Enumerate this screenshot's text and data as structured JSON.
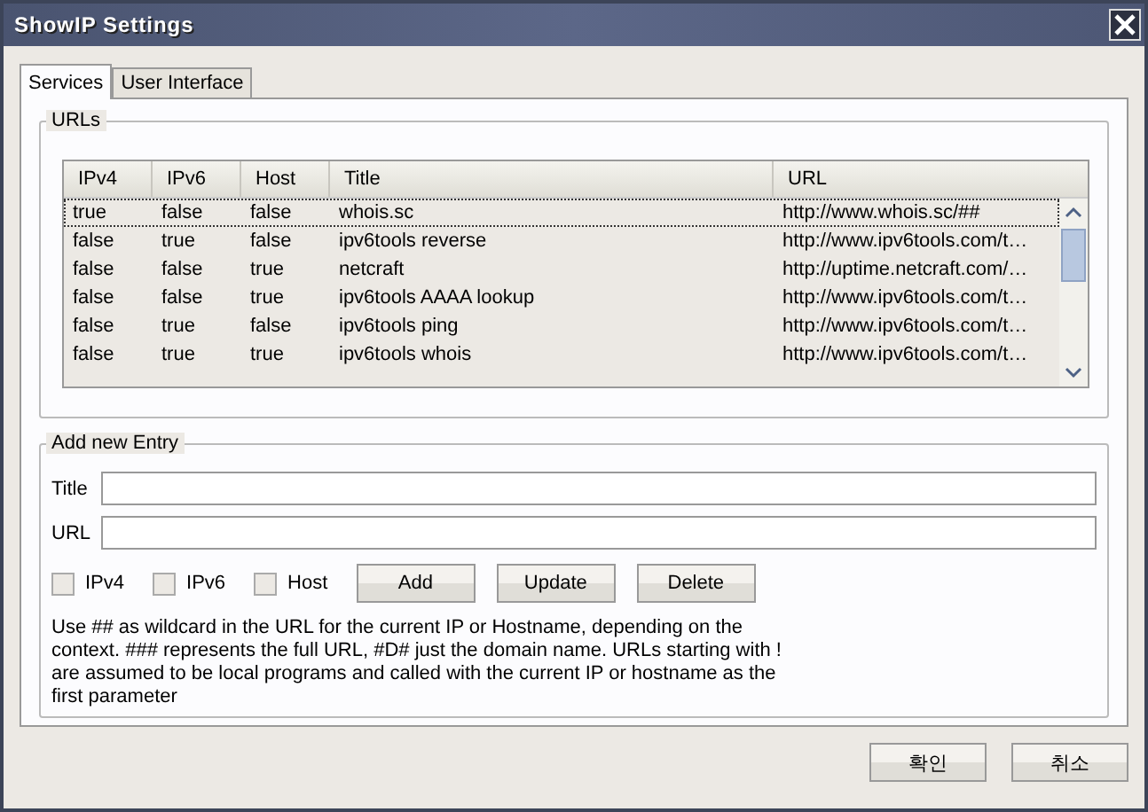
{
  "window": {
    "title": "ShowIP Settings"
  },
  "tabs": [
    {
      "label": "Services",
      "selected": true
    },
    {
      "label": "User Interface",
      "selected": false
    }
  ],
  "urls_group": {
    "title": "URLs",
    "table": {
      "columns": [
        "IPv4",
        "IPv6",
        "Host",
        "Title",
        "URL"
      ],
      "rows": [
        {
          "cells": [
            "true",
            "false",
            "false",
            "whois.sc",
            "http://www.whois.sc/##"
          ],
          "selected": true
        },
        {
          "cells": [
            "false",
            "true",
            "false",
            "ipv6tools reverse",
            "http://www.ipv6tools.com/t…"
          ],
          "selected": false
        },
        {
          "cells": [
            "false",
            "false",
            "true",
            "netcraft",
            "http://uptime.netcraft.com/…"
          ],
          "selected": false
        },
        {
          "cells": [
            "false",
            "false",
            "true",
            "ipv6tools AAAA lookup",
            "http://www.ipv6tools.com/t…"
          ],
          "selected": false
        },
        {
          "cells": [
            "false",
            "true",
            "false",
            "ipv6tools ping",
            "http://www.ipv6tools.com/t…"
          ],
          "selected": false
        },
        {
          "cells": [
            "false",
            "true",
            "true",
            "ipv6tools whois",
            "http://www.ipv6tools.com/t…"
          ],
          "selected": false
        }
      ]
    }
  },
  "entry_group": {
    "title": "Add new Entry",
    "fields": [
      {
        "label": "Title"
      },
      {
        "label": "URL"
      }
    ],
    "checkboxes": [
      {
        "label": "IPv4",
        "checked": false
      },
      {
        "label": "IPv6",
        "checked": false
      },
      {
        "label": "Host",
        "checked": false
      }
    ],
    "buttons": [
      "Add",
      "Update",
      "Delete"
    ],
    "help": "Use ## as wildcard in the URL for the current IP or Hostname, depending on the context. ### represents the full URL, #D# just the domain name. URLs starting with ! are assumed to be local programs and called with the current IP or hostname as the first parameter"
  },
  "buttons": [
    "확인",
    "취소"
  ]
}
